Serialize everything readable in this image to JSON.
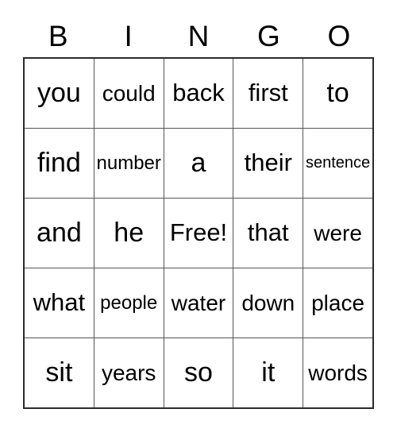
{
  "card": {
    "title": "BINGO",
    "free_space_label": "Free!",
    "header": {
      "letters": [
        "B",
        "I",
        "N",
        "G",
        "O"
      ]
    },
    "grid": {
      "columns": 5,
      "rows": 5,
      "border_color": "#2b2b2b",
      "line_color": "#555555",
      "background": "#ffffff",
      "text_color": "#000000",
      "cells": [
        [
          {
            "text": "you",
            "size": "fs-xl"
          },
          {
            "text": "could",
            "size": "fs-md"
          },
          {
            "text": "back",
            "size": "fs-lg"
          },
          {
            "text": "first",
            "size": "fs-lg"
          },
          {
            "text": "to",
            "size": "fs-xl"
          }
        ],
        [
          {
            "text": "find",
            "size": "fs-xl"
          },
          {
            "text": "number",
            "size": "fs-sm"
          },
          {
            "text": "a",
            "size": "fs-xl"
          },
          {
            "text": "their",
            "size": "fs-lg"
          },
          {
            "text": "sentence",
            "size": "fs-xs"
          }
        ],
        [
          {
            "text": "and",
            "size": "fs-xl"
          },
          {
            "text": "he",
            "size": "fs-xl"
          },
          {
            "text": "Free!",
            "size": "fs-lg"
          },
          {
            "text": "that",
            "size": "fs-lg"
          },
          {
            "text": "were",
            "size": "fs-md"
          }
        ],
        [
          {
            "text": "what",
            "size": "fs-lg"
          },
          {
            "text": "people",
            "size": "fs-sm"
          },
          {
            "text": "water",
            "size": "fs-md"
          },
          {
            "text": "down",
            "size": "fs-md"
          },
          {
            "text": "place",
            "size": "fs-md"
          }
        ],
        [
          {
            "text": "sit",
            "size": "fs-xl"
          },
          {
            "text": "years",
            "size": "fs-md"
          },
          {
            "text": "so",
            "size": "fs-xl"
          },
          {
            "text": "it",
            "size": "fs-xl"
          },
          {
            "text": "words",
            "size": "fs-md"
          }
        ]
      ]
    }
  }
}
